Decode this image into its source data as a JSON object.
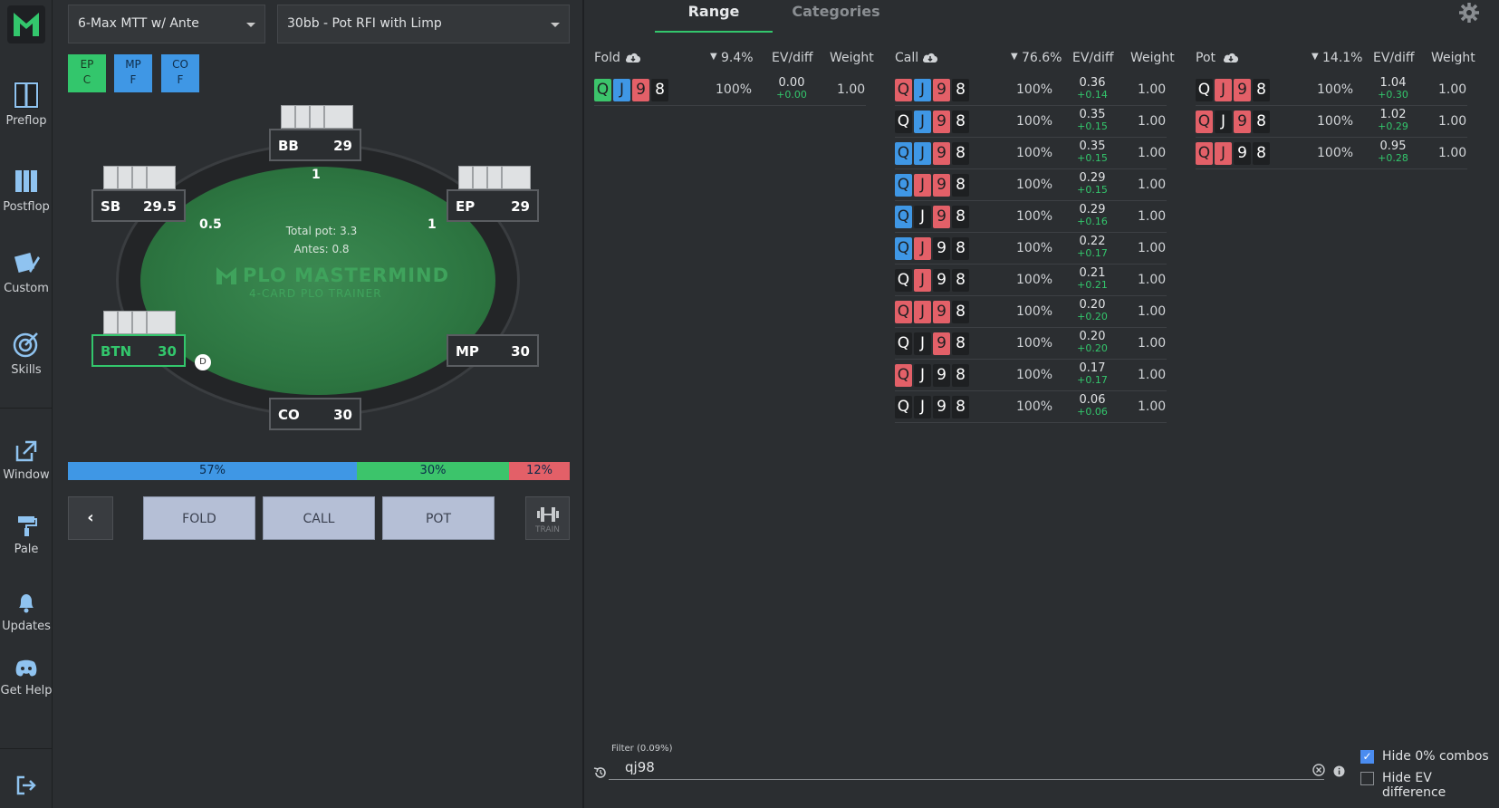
{
  "sidebar": {
    "items": [
      {
        "label": "Preflop",
        "icon": "preflop-icon"
      },
      {
        "label": "Postflop",
        "icon": "postflop-icon"
      },
      {
        "label": "Custom",
        "icon": "custom-icon"
      },
      {
        "label": "Skills",
        "icon": "target-icon"
      },
      {
        "label": "Window",
        "icon": "external-window-icon"
      },
      {
        "label": "Pale",
        "icon": "paint-roller-icon"
      },
      {
        "label": "Updates",
        "icon": "bell-icon"
      },
      {
        "label": "Get Help",
        "icon": "discord-icon"
      }
    ]
  },
  "selects": {
    "format": "6-Max MTT w/ Ante",
    "scenario": "30bb - Pot RFI with Limp"
  },
  "action_chips": [
    {
      "pos": "EP",
      "act": "C",
      "color": "#33c66c"
    },
    {
      "pos": "MP",
      "act": "F",
      "color": "#3f97e5"
    },
    {
      "pos": "CO",
      "act": "F",
      "color": "#3f97e5"
    }
  ],
  "table": {
    "total_pot": "Total pot: 3.3",
    "antes": "Antes: 0.8",
    "brand": "PLO MASTERMIND",
    "brand_sub": "4-CARD PLO TRAINER",
    "dealer": "D",
    "seats": [
      {
        "name": "BB",
        "stack": "29",
        "bet": "1"
      },
      {
        "name": "SB",
        "stack": "29.5",
        "bet": "0.5"
      },
      {
        "name": "EP",
        "stack": "29",
        "bet": "1"
      },
      {
        "name": "BTN",
        "stack": "30"
      },
      {
        "name": "MP",
        "stack": "30"
      },
      {
        "name": "CO",
        "stack": "30"
      }
    ]
  },
  "frequencies": [
    {
      "label": "57%",
      "value": 57,
      "color": "#3f97e5"
    },
    {
      "label": "30%",
      "value": 30,
      "color": "#3cc46b"
    },
    {
      "label": "12%",
      "value": 12,
      "color": "#e36068"
    }
  ],
  "actions": {
    "back": "‹",
    "fold": "FOLD",
    "call": "CALL",
    "pot": "POT",
    "train": "TRAIN"
  },
  "tabs": {
    "range": "Range",
    "categories": "Categories"
  },
  "columns": {
    "fold": {
      "title": "Fold",
      "pct": "9.4%",
      "ev_header": "EV/diff",
      "weight_header": "Weight",
      "rows": [
        {
          "cards": [
            [
              "Q",
              "g"
            ],
            [
              "J",
              "u"
            ],
            [
              "9",
              "r"
            ],
            [
              "8",
              "b"
            ]
          ],
          "freq": "100%",
          "ev": "0.00",
          "diff": "+0.00",
          "weight": "1.00"
        }
      ]
    },
    "call": {
      "title": "Call",
      "pct": "76.6%",
      "ev_header": "EV/diff",
      "weight_header": "Weight",
      "rows": [
        {
          "cards": [
            [
              "Q",
              "r"
            ],
            [
              "J",
              "u"
            ],
            [
              "9",
              "r"
            ],
            [
              "8",
              "b"
            ]
          ],
          "freq": "100%",
          "ev": "0.36",
          "diff": "+0.14",
          "weight": "1.00"
        },
        {
          "cards": [
            [
              "Q",
              "b"
            ],
            [
              "J",
              "u"
            ],
            [
              "9",
              "r"
            ],
            [
              "8",
              "b"
            ]
          ],
          "freq": "100%",
          "ev": "0.35",
          "diff": "+0.15",
          "weight": "1.00"
        },
        {
          "cards": [
            [
              "Q",
              "u"
            ],
            [
              "J",
              "u"
            ],
            [
              "9",
              "r"
            ],
            [
              "8",
              "b"
            ]
          ],
          "freq": "100%",
          "ev": "0.35",
          "diff": "+0.15",
          "weight": "1.00"
        },
        {
          "cards": [
            [
              "Q",
              "u"
            ],
            [
              "J",
              "r"
            ],
            [
              "9",
              "r"
            ],
            [
              "8",
              "b"
            ]
          ],
          "freq": "100%",
          "ev": "0.29",
          "diff": "+0.15",
          "weight": "1.00"
        },
        {
          "cards": [
            [
              "Q",
              "u"
            ],
            [
              "J",
              "b"
            ],
            [
              "9",
              "r"
            ],
            [
              "8",
              "b"
            ]
          ],
          "freq": "100%",
          "ev": "0.29",
          "diff": "+0.16",
          "weight": "1.00"
        },
        {
          "cards": [
            [
              "Q",
              "u"
            ],
            [
              "J",
              "r"
            ],
            [
              "9",
              "b"
            ],
            [
              "8",
              "b"
            ]
          ],
          "freq": "100%",
          "ev": "0.22",
          "diff": "+0.17",
          "weight": "1.00"
        },
        {
          "cards": [
            [
              "Q",
              "b"
            ],
            [
              "J",
              "r"
            ],
            [
              "9",
              "b"
            ],
            [
              "8",
              "b"
            ]
          ],
          "freq": "100%",
          "ev": "0.21",
          "diff": "+0.21",
          "weight": "1.00"
        },
        {
          "cards": [
            [
              "Q",
              "r"
            ],
            [
              "J",
              "r"
            ],
            [
              "9",
              "r"
            ],
            [
              "8",
              "b"
            ]
          ],
          "freq": "100%",
          "ev": "0.20",
          "diff": "+0.20",
          "weight": "1.00"
        },
        {
          "cards": [
            [
              "Q",
              "b"
            ],
            [
              "J",
              "b"
            ],
            [
              "9",
              "r"
            ],
            [
              "8",
              "b"
            ]
          ],
          "freq": "100%",
          "ev": "0.20",
          "diff": "+0.20",
          "weight": "1.00"
        },
        {
          "cards": [
            [
              "Q",
              "r"
            ],
            [
              "J",
              "b"
            ],
            [
              "9",
              "b"
            ],
            [
              "8",
              "b"
            ]
          ],
          "freq": "100%",
          "ev": "0.17",
          "diff": "+0.17",
          "weight": "1.00"
        },
        {
          "cards": [
            [
              "Q",
              "b"
            ],
            [
              "J",
              "b"
            ],
            [
              "9",
              "b"
            ],
            [
              "8",
              "b"
            ]
          ],
          "freq": "100%",
          "ev": "0.06",
          "diff": "+0.06",
          "weight": "1.00"
        }
      ]
    },
    "pot": {
      "title": "Pot",
      "pct": "14.1%",
      "ev_header": "EV/diff",
      "weight_header": "Weight",
      "rows": [
        {
          "cards": [
            [
              "Q",
              "b"
            ],
            [
              "J",
              "r"
            ],
            [
              "9",
              "r"
            ],
            [
              "8",
              "b"
            ]
          ],
          "freq": "100%",
          "ev": "1.04",
          "diff": "+0.30",
          "weight": "1.00"
        },
        {
          "cards": [
            [
              "Q",
              "r"
            ],
            [
              "J",
              "b"
            ],
            [
              "9",
              "r"
            ],
            [
              "8",
              "b"
            ]
          ],
          "freq": "100%",
          "ev": "1.02",
          "diff": "+0.29",
          "weight": "1.00"
        },
        {
          "cards": [
            [
              "Q",
              "r"
            ],
            [
              "J",
              "r"
            ],
            [
              "9",
              "b"
            ],
            [
              "8",
              "b"
            ]
          ],
          "freq": "100%",
          "ev": "0.95",
          "diff": "+0.28",
          "weight": "1.00"
        }
      ]
    }
  },
  "filter": {
    "label": "Filter (0.09%)",
    "value": "qj98"
  },
  "options": {
    "hide_zero": "Hide 0% combos",
    "hide_ev": "Hide EV difference"
  }
}
